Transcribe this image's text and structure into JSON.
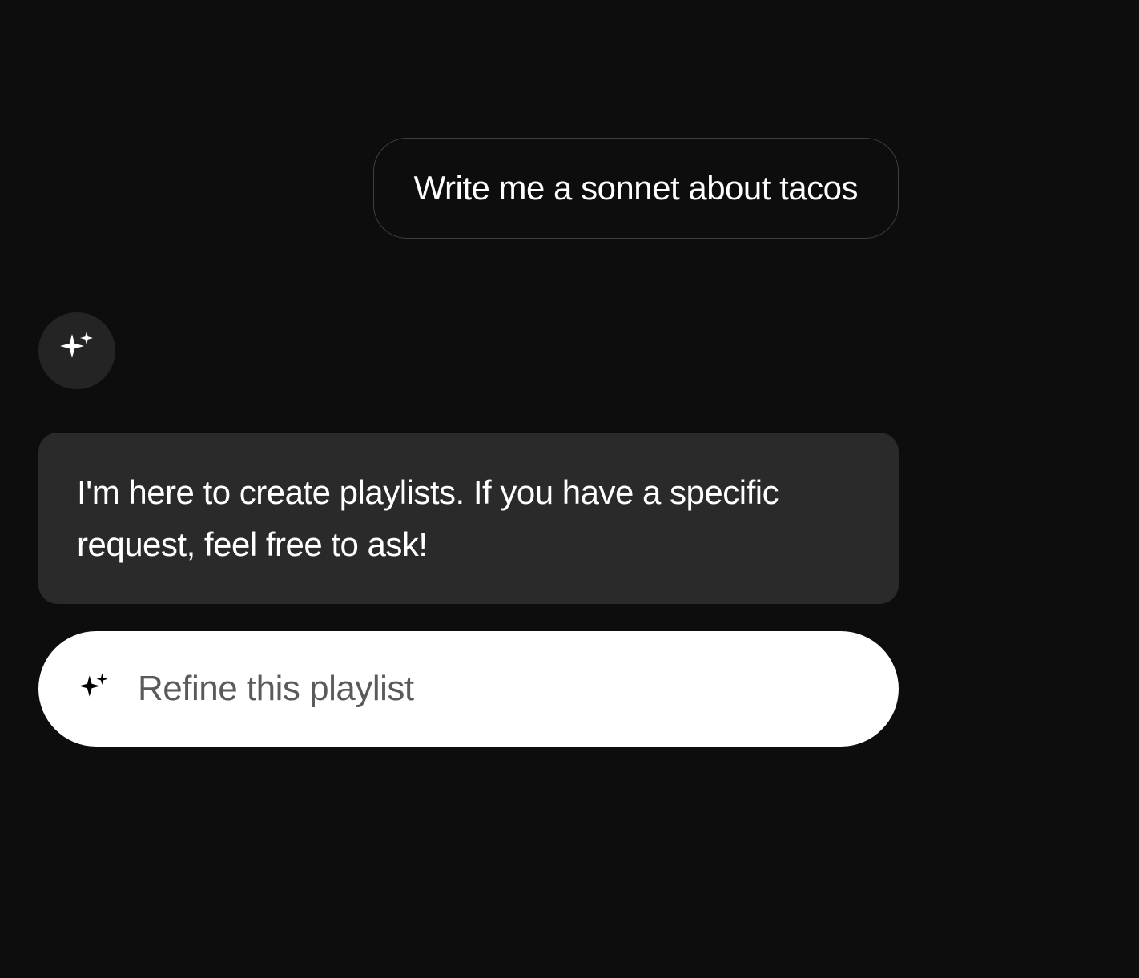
{
  "conversation": {
    "user_message": "Write me a sonnet about tacos",
    "assistant_message": "I'm here to create playlists. If you have a specific request, feel free to ask!"
  },
  "input": {
    "placeholder": "Refine this playlist"
  }
}
